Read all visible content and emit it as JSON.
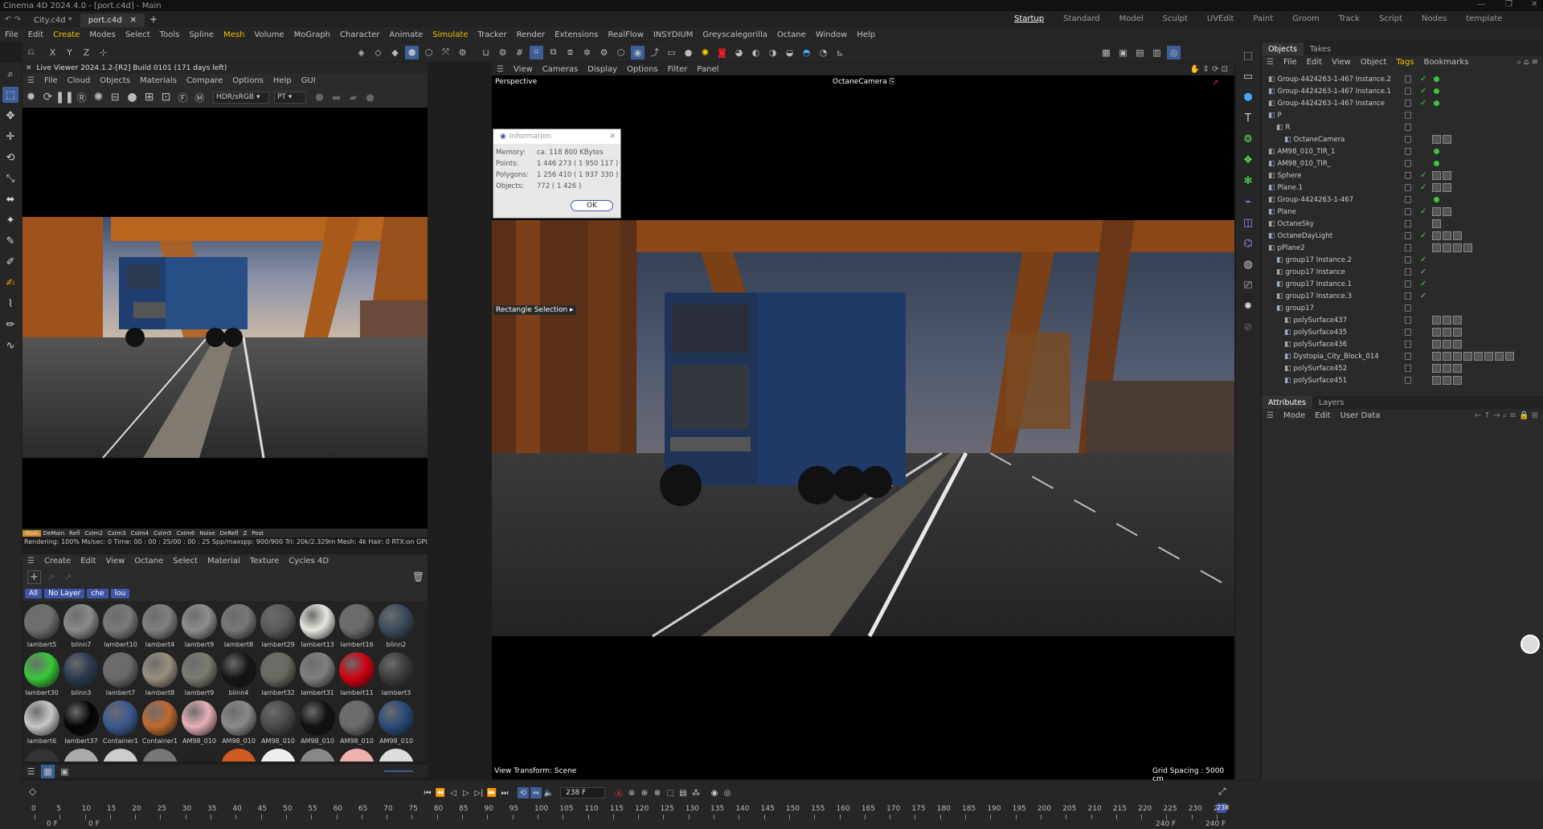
{
  "window": {
    "title": "Cinema 4D 2024.4.0 - [port.c4d] - Main"
  },
  "doc_tabs": [
    {
      "label": "City.c4d *"
    },
    {
      "label": "port.c4d"
    }
  ],
  "layouts": [
    "Startup",
    "Standard",
    "Model",
    "Sculpt",
    "UVEdit",
    "Paint",
    "Groom",
    "Track",
    "Script",
    "Nodes",
    "template"
  ],
  "menu": [
    "File",
    "Edit",
    "Create",
    "Modes",
    "Select",
    "Tools",
    "Spline",
    "Mesh",
    "Volume",
    "MoGraph",
    "Character",
    "Animate",
    "Simulate",
    "Tracker",
    "Render",
    "Extensions",
    "RealFlow",
    "INSYDIUM",
    "Greyscalegorilla",
    "Octane",
    "Window",
    "Help"
  ],
  "live_viewer": {
    "title": "Live Viewer 2024.1.2-[R2] Build 0101 (171 days left)",
    "menu": [
      "File",
      "Cloud",
      "Objects",
      "Materials",
      "Compare",
      "Options",
      "Help",
      "GUI"
    ],
    "color_mode": "HDR/sRGB",
    "kernel": "PT",
    "passes": [
      "Main",
      "DeMain",
      "Refl",
      "Cstm2",
      "Cstm3",
      "Cstm4",
      "Cstm5",
      "Cstm6",
      "Noise",
      "DeRefl",
      "Z",
      "Post"
    ],
    "status": "Rendering: 100%   Ms/sec: 0   Time: 00 : 00 : 25/00 : 00 : 25   Spp/maxspp: 900/900   Tri: 20k/2.329m   Mesh: 4k   Hair: 0   RTX:on   GPU:"
  },
  "material_manager": {
    "menu": [
      "Create",
      "Edit",
      "View",
      "Octane",
      "Select",
      "Material",
      "Texture",
      "Cycles 4D"
    ],
    "filters": [
      "All",
      "No Layer",
      "che",
      "lou"
    ],
    "materials": [
      {
        "name": "lambert5",
        "color": "#6e6e6e"
      },
      {
        "name": "blinn7",
        "color": "#8a8a8a"
      },
      {
        "name": "lambert10",
        "color": "#7a7a7a"
      },
      {
        "name": "lambert4",
        "color": "#808080"
      },
      {
        "name": "lambert9",
        "color": "#8e8e8e"
      },
      {
        "name": "lambert8",
        "color": "#777777"
      },
      {
        "name": "lambert29",
        "color": "#5a5a5a"
      },
      {
        "name": "lambert13",
        "color": "#e8e8e0"
      },
      {
        "name": "lambert16",
        "color": "#6a6a6a"
      },
      {
        "name": "blinn2",
        "color": "#3a4a5a"
      },
      {
        "name": "lambert30",
        "color": "#38c838"
      },
      {
        "name": "blinn3",
        "color": "#2a3a4e"
      },
      {
        "name": "lambert7",
        "color": "#6a6a6a"
      },
      {
        "name": "lambert8",
        "color": "#9a8f80"
      },
      {
        "name": "lambert9",
        "color": "#7c7c70"
      },
      {
        "name": "blinn4",
        "color": "#151515"
      },
      {
        "name": "lambert32",
        "color": "#6a6a60"
      },
      {
        "name": "lambert31",
        "color": "#808080"
      },
      {
        "name": "lambert11",
        "color": "#d00010"
      },
      {
        "name": "lambert3",
        "color": "#3c3c3c"
      },
      {
        "name": "lambert6",
        "color": "#c8c8c8"
      },
      {
        "name": "lambert37",
        "color": "#050505"
      },
      {
        "name": "Container1",
        "color": "#3a5a90"
      },
      {
        "name": "Container1",
        "color": "#c06a30"
      },
      {
        "name": "AM98_010",
        "color": "#e8b0b8"
      },
      {
        "name": "AM98_010",
        "color": "#8a8a8a"
      },
      {
        "name": "AM98_010",
        "color": "#4a4a4a"
      },
      {
        "name": "AM98_010",
        "color": "#111111"
      },
      {
        "name": "AM98_010",
        "color": "#6a6a6a"
      },
      {
        "name": "AM98_010",
        "color": "#2a4a7a"
      }
    ]
  },
  "viewport": {
    "menu": [
      "View",
      "Cameras",
      "Display",
      "Options",
      "Filter",
      "Panel"
    ],
    "name": "Perspective",
    "camera": "OctaneCamera",
    "tooltip": "Rectangle Selection",
    "view_transform": "View Transform: Scene",
    "grid_spacing": "Grid Spacing : 5000 cm"
  },
  "info_dialog": {
    "title": "Information",
    "rows": [
      {
        "label": "Memory:",
        "value": "ca. 118 800 KBytes"
      },
      {
        "label": "Points:",
        "value": "1 446 273 ( 1 950 117 )"
      },
      {
        "label": "Polygons:",
        "value": "1 256 410 ( 1 937 330 )"
      },
      {
        "label": "Objects:",
        "value": "772 ( 1 426 )"
      }
    ],
    "ok": "OK"
  },
  "object_manager": {
    "tabs": [
      "Objects",
      "Takes"
    ],
    "menu": [
      "File",
      "Edit",
      "View",
      "Object",
      "Tags",
      "Bookmarks"
    ],
    "objects": [
      {
        "name": "Group-4424263-1-467 Instance.2",
        "indent": 0
      },
      {
        "name": "Group-4424263-1-467 Instance.1",
        "indent": 0
      },
      {
        "name": "Group-4424263-1-467 Instance",
        "indent": 0
      },
      {
        "name": "P",
        "indent": 0
      },
      {
        "name": "R",
        "indent": 1
      },
      {
        "name": "OctaneCamera",
        "indent": 2
      },
      {
        "name": "AM98_010_TIR_1",
        "indent": 0
      },
      {
        "name": "AM98_010_TIR_",
        "indent": 0
      },
      {
        "name": "Sphere",
        "indent": 0
      },
      {
        "name": "Plane.1",
        "indent": 0
      },
      {
        "name": "Group-4424263-1-467",
        "indent": 0
      },
      {
        "name": "Plane",
        "indent": 0
      },
      {
        "name": "OctaneSky",
        "indent": 0
      },
      {
        "name": "OctaneDayLight",
        "indent": 0
      },
      {
        "name": "pPlane2",
        "indent": 0
      },
      {
        "name": "group17 Instance.2",
        "indent": 1
      },
      {
        "name": "group17 Instance",
        "indent": 1
      },
      {
        "name": "group17 Instance.1",
        "indent": 1
      },
      {
        "name": "group17 Instance.3",
        "indent": 1
      },
      {
        "name": "group17",
        "indent": 1
      },
      {
        "name": "polySurface437",
        "indent": 2
      },
      {
        "name": "polySurface435",
        "indent": 2
      },
      {
        "name": "polySurface436",
        "indent": 2
      },
      {
        "name": "Dystopia_City_Block_014",
        "indent": 2
      },
      {
        "name": "polySurface452",
        "indent": 2
      },
      {
        "name": "polySurface451",
        "indent": 2
      }
    ]
  },
  "attributes": {
    "tabs": [
      "Attributes",
      "Layers"
    ],
    "menu": [
      "Mode",
      "Edit",
      "User Data"
    ]
  },
  "timeline": {
    "current_frame": "238 F",
    "start_a": "0 F",
    "start_b": "0 F",
    "end_a": "240 F",
    "end_b": "240 F",
    "ticks": [
      "0",
      "5",
      "10",
      "15",
      "20",
      "25",
      "30",
      "35",
      "40",
      "45",
      "50",
      "55",
      "60",
      "65",
      "70",
      "75",
      "80",
      "85",
      "90",
      "95",
      "100",
      "105",
      "110",
      "115",
      "120",
      "125",
      "130",
      "135",
      "140",
      "145",
      "150",
      "155",
      "160",
      "165",
      "170",
      "175",
      "180",
      "185",
      "190",
      "195",
      "200",
      "205",
      "210",
      "215",
      "220",
      "225",
      "230",
      "235"
    ],
    "playhead_label": "238"
  }
}
